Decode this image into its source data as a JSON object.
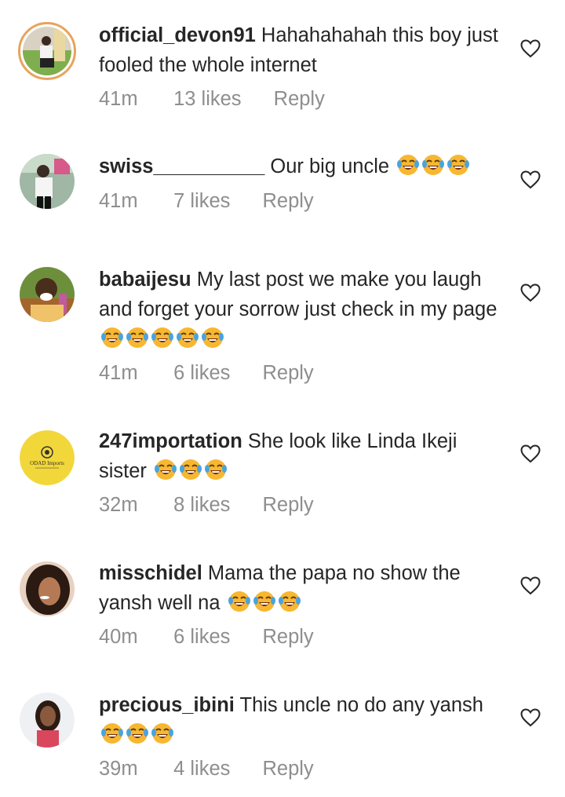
{
  "comments": [
    {
      "username": "official_devon91",
      "text": "Hahahahahah this boy just fooled the whole internet",
      "emojis": 0,
      "time": "41m",
      "likes": "13 likes",
      "reply": "Reply"
    },
    {
      "username": "swiss__________",
      "text": "Our big uncle",
      "emojis": 3,
      "time": "41m",
      "likes": "7 likes",
      "reply": "Reply"
    },
    {
      "username": "babaijesu",
      "text": "My last post we make you laugh and forget your sorrow just check in my page",
      "emojis": 5,
      "time": "41m",
      "likes": "6 likes",
      "reply": "Reply"
    },
    {
      "username": "247importation",
      "text": "She look like Linda Ikeji sister",
      "emojis": 3,
      "time": "32m",
      "likes": "8 likes",
      "reply": "Reply"
    },
    {
      "username": "misschidel",
      "text": "Mama the papa no show the yansh well na",
      "emojis": 3,
      "time": "40m",
      "likes": "6 likes",
      "reply": "Reply"
    },
    {
      "username": "precious_ibini",
      "text": "This uncle no do any yansh",
      "emojis": 3,
      "time": "39m",
      "likes": "4 likes",
      "reply": "Reply"
    }
  ],
  "avatar_logo_text": "ODAD Imports",
  "icons": {
    "like": "heart-outline-icon",
    "emoji": "face-with-tears-of-joy-emoji"
  },
  "colors": {
    "text": "#262626",
    "meta": "#8e8e8e",
    "story_ring": "#e9a35c",
    "emoji_face": "#f7b731"
  }
}
